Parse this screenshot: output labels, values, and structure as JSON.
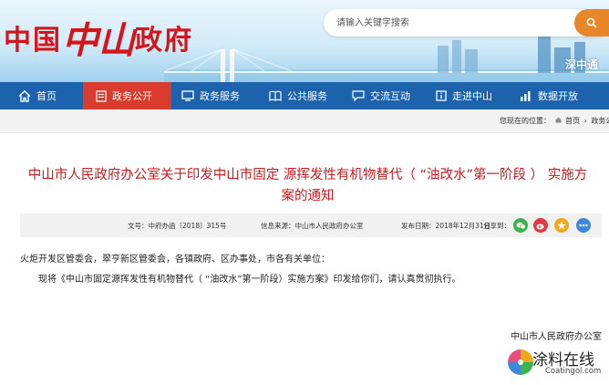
{
  "header": {
    "logo_part1": "中国",
    "logo_part2": "中山",
    "logo_part3": "政府",
    "search_placeholder": "请输入关键字搜索",
    "tagline": "深中通"
  },
  "nav": {
    "items": [
      {
        "label": "首页",
        "icon": "home-icon"
      },
      {
        "label": "政务公开",
        "icon": "document-icon",
        "active": true
      },
      {
        "label": "政务服务",
        "icon": "monitor-icon"
      },
      {
        "label": "公共服务",
        "icon": "book-icon"
      },
      {
        "label": "交流互动",
        "icon": "chat-icon"
      },
      {
        "label": "走进中山",
        "icon": "info-icon"
      },
      {
        "label": "数据开放",
        "icon": "bar-chart-icon"
      }
    ],
    "colors": {
      "bar": "#1c62ad",
      "active": "#d93b2c"
    }
  },
  "breadcrumb": {
    "prefix": "您现在的位置：",
    "items": [
      "首页",
      "政务公"
    ]
  },
  "article": {
    "title": "中山市人民政府办公室关于印发中山市固定 源挥发性有机物替代（ “油改水”第一阶段 ） 实施方案的通知",
    "title_color": "#c8191f",
    "meta": {
      "doc_no": "文号：中府办函〔2018〕315号",
      "source": "信息来源：中山市人民政府办公室",
      "date": "发布日期：2018年12月31日",
      "share_label": "分享到："
    },
    "salutation": "火炬开发区管委会，翠亨新区管委会，各镇政府、区办事处，市各有关单位：",
    "body": "现将《中山市固定源挥发性有机物替代（ “油改水”第一阶段）实施方案》印发给你们，请认真贯彻执行。",
    "signature": "中山市人民政府办公室"
  },
  "watermark": {
    "text": "涂料在线",
    "sub": "Coatingol.com"
  }
}
